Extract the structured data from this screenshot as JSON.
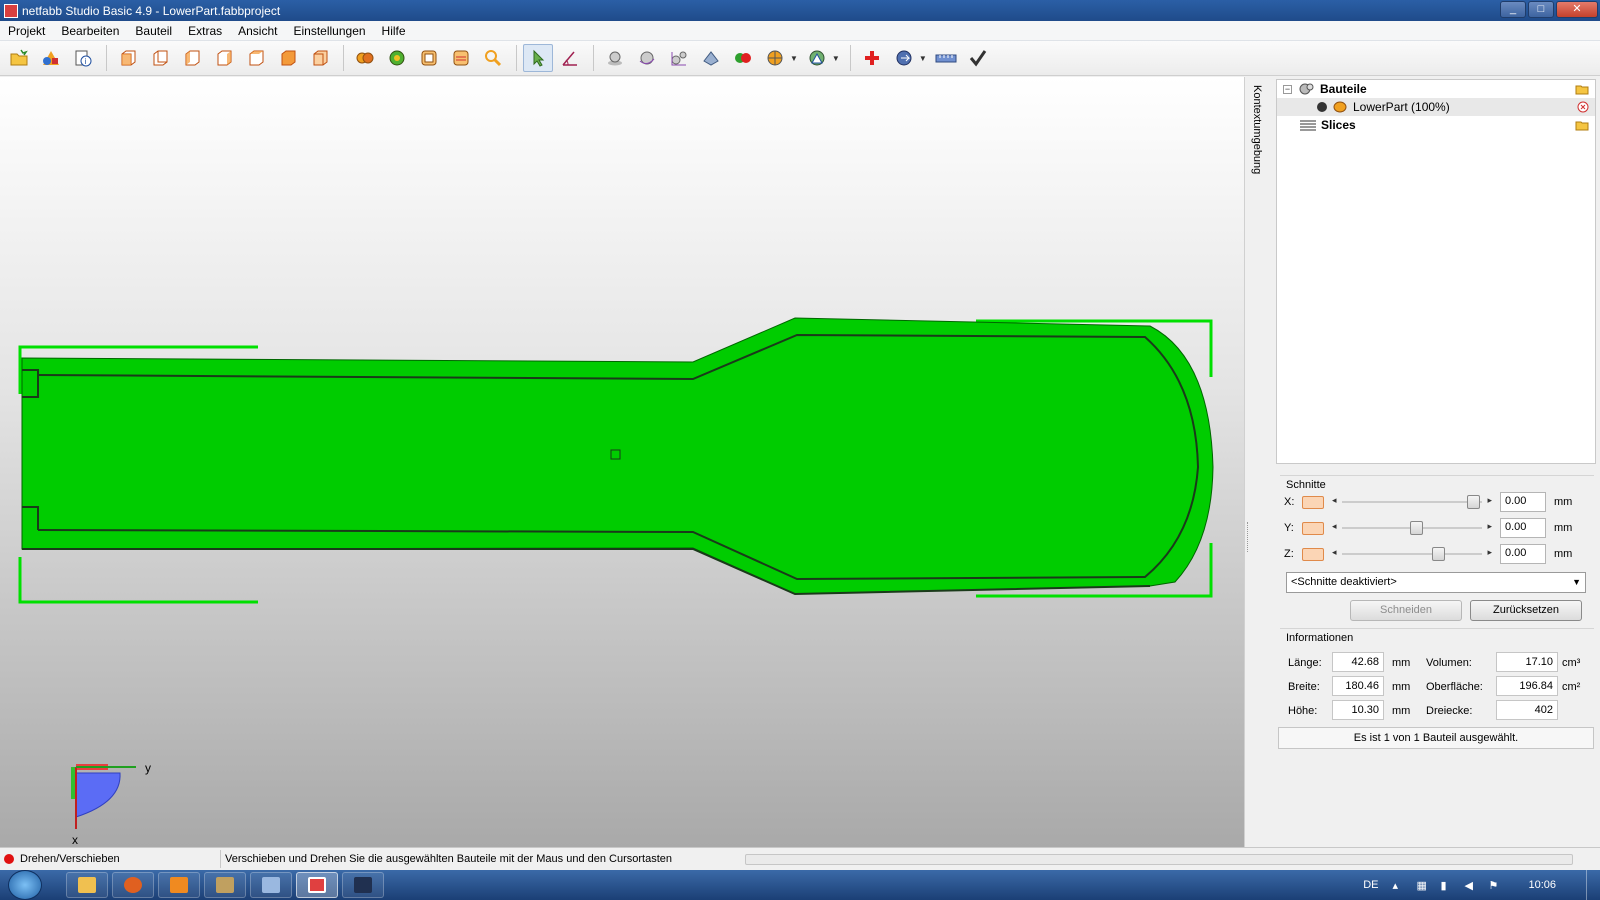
{
  "window": {
    "title": "netfabb Studio Basic 4.9 - LowerPart.fabbproject",
    "controls": [
      "_",
      "□",
      "✕"
    ]
  },
  "menu": {
    "items": [
      "Projekt",
      "Bearbeiten",
      "Bauteil",
      "Extras",
      "Ansicht",
      "Einstellungen",
      "Hilfe"
    ]
  },
  "toolbar": {
    "buttons": [
      "open-project-icon",
      "add-part-icon",
      "project-info-icon",
      "view-front-icon",
      "view-back-icon",
      "view-left-icon",
      "view-right-icon",
      "view-top-icon",
      "view-bottom-icon",
      "view-perspective-icon",
      "view-shaded-icon",
      "view-wireframe-icon",
      "view-bounding-icon",
      "zoom-icon",
      "select-pointer-icon",
      "measure-angle-icon",
      "move-part-icon",
      "rotate-part-icon",
      "scale-part-icon",
      "mirror-part-icon",
      "boolean-icon",
      "section-icon",
      "analysis-icon",
      "repair-icon",
      "export-icon",
      "ruler-icon",
      "check-icon"
    ],
    "active_button": "select-pointer-icon"
  },
  "viewport": {
    "part_color": "#00cc00",
    "outline_color": "#00e000",
    "background_top": "#ffffff",
    "background_bottom": "#a9a9a9",
    "axes": {
      "y_label": "y",
      "x_label": "x"
    }
  },
  "side_tab": {
    "label": "Kontextumgebung"
  },
  "tree": {
    "items": [
      {
        "label": "Bauteile",
        "bold": true
      },
      {
        "label": "LowerPart (100%)",
        "bold": false
      },
      {
        "label": "Slices",
        "bold": true
      }
    ]
  },
  "schnitte": {
    "title": "Schnitte",
    "axes": [
      {
        "label": "X:",
        "value": "0.00",
        "unit": "mm",
        "slider_fraction": 1.0
      },
      {
        "label": "Y:",
        "value": "0.00",
        "unit": "mm",
        "slider_fraction": 0.55
      },
      {
        "label": "Z:",
        "value": "0.00",
        "unit": "mm",
        "slider_fraction": 0.72
      }
    ],
    "mode_select": "<Schnitte deaktiviert>",
    "cut_button": "Schneiden",
    "reset_button": "Zurücksetzen"
  },
  "info": {
    "title": "Informationen",
    "laenge_label": "Länge:",
    "laenge_value": "42.68",
    "breite_label": "Breite:",
    "breite_value": "180.46",
    "hoehe_label": "Höhe:",
    "hoehe_value": "10.30",
    "mm": "mm",
    "volumen_label": "Volumen:",
    "volumen_value": "17.10",
    "volumen_unit": "cm³",
    "oberflaeche_label": "Oberfläche:",
    "oberflaeche_value": "196.84",
    "oberflaeche_unit": "cm²",
    "dreiecke_label": "Dreiecke:",
    "dreiecke_value": "402",
    "selection_status": "Es ist 1 von 1 Bauteil ausgewählt."
  },
  "statusbar": {
    "mode": "Drehen/Verschieben",
    "hint": "Verschieben und Drehen Sie die ausgewählten Bauteile mit der Maus und den Cursortasten"
  },
  "taskbar": {
    "apps": [
      "explorer-icon",
      "firefox-icon",
      "media-player-icon",
      "tools-icon",
      "window-icon",
      "netfabb-icon",
      "terminal-icon"
    ],
    "active_app": "netfabb-icon",
    "language": "DE",
    "time": "10:06"
  }
}
